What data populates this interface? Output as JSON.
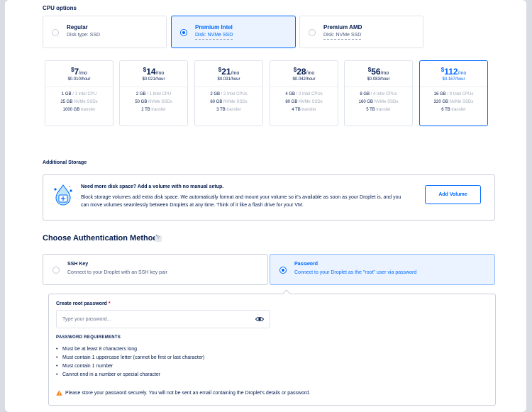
{
  "cpu_options": {
    "title": "CPU options",
    "options": [
      {
        "name": "Regular",
        "disk": "Disk type: SSD",
        "selected": false
      },
      {
        "name": "Premium Intel",
        "disk": "Disk: NVMe SSD",
        "selected": true
      },
      {
        "name": "Premium AMD",
        "disk": "Disk: NVMe SSD",
        "selected": false
      }
    ]
  },
  "plans": [
    {
      "dollar": "$",
      "price": "7",
      "per": "/mo",
      "hourly": "$0.010/hour",
      "spec1": "1 GB / 1 Intel CPU",
      "spec1_a": "1 GB",
      "spec1_b": " / 1 Intel CPU",
      "spec2_a": "25 GB",
      "spec2_b": " NVMe SSDs",
      "spec3_a": "1000 GB",
      "spec3_b": " transfer",
      "selected": false
    },
    {
      "dollar": "$",
      "price": "14",
      "per": "/mo",
      "hourly": "$0.021/hour",
      "spec1_a": "2 GB",
      "spec1_b": " / 1 Intel CPU",
      "spec2_a": "50 GB",
      "spec2_b": " NVMe SSDs",
      "spec3_a": "2 TB",
      "spec3_b": " transfer",
      "selected": false
    },
    {
      "dollar": "$",
      "price": "21",
      "per": "/mo",
      "hourly": "$0.031/hour",
      "spec1_a": "2 GB",
      "spec1_b": " / 2 Intel CPUs",
      "spec2_a": "60 GB",
      "spec2_b": " NVMe SSDs",
      "spec3_a": "3 TB",
      "spec3_b": " transfer",
      "selected": false
    },
    {
      "dollar": "$",
      "price": "28",
      "per": "/mo",
      "hourly": "$0.042/hour",
      "spec1_a": "4 GB",
      "spec1_b": " / 2 Intel CPUs",
      "spec2_a": "80 GB",
      "spec2_b": " NVMe SSDs",
      "spec3_a": "4 TB",
      "spec3_b": " transfer",
      "selected": false
    },
    {
      "dollar": "$",
      "price": "56",
      "per": "/mo",
      "hourly": "$0.083/hour",
      "spec1_a": "8 GB",
      "spec1_b": " / 4 Intel CPUs",
      "spec2_a": "160 GB",
      "spec2_b": " NVMe SSDs",
      "spec3_a": "5 TB",
      "spec3_b": " transfer",
      "selected": false
    },
    {
      "dollar": "$",
      "price": "112",
      "per": "/mo",
      "hourly": "$0.167/hour",
      "spec1_a": "16 GB",
      "spec1_b": " / 8 Intel CPUs",
      "spec2_a": "320 GB",
      "spec2_b": " NVMe SSDs",
      "spec3_a": "6 TB",
      "spec3_b": " transfer",
      "selected": true
    }
  ],
  "storage": {
    "title": "Additional Storage",
    "headline": "Need more disk space? Add a volume with no manual setup.",
    "body": "Block storage volumes add extra disk space. We automatically format and mount your volume so it's available as soon as your Droplet is, and you can move volumes seamlessly between Droplets at any time. Think of it like a flash drive for your VM.",
    "button": "Add Volume"
  },
  "auth": {
    "title": "Choose Authentication Method",
    "help": "?",
    "options": [
      {
        "name": "SSH Key",
        "desc": "Connect to your Droplet with an SSH key pair",
        "selected": false
      },
      {
        "name": "Password",
        "desc": "Connect to your Droplet as the \"root\" user via password",
        "selected": true
      }
    ],
    "password": {
      "label": "Create root password",
      "required_mark": "*",
      "placeholder": "Type your password...",
      "value": "",
      "requirements_title": "PASSWORD REQUIREMENTS",
      "requirements": [
        "Must be at least 8 characters long",
        "Must contain 1 uppercase letter (cannot be first or last character)",
        "Must contain 1 number",
        "Cannot end in a number or special character"
      ],
      "warning": "Please store your password securely. You will not be sent an email containing the Droplet's details or password."
    }
  },
  "colors": {
    "accent": "#0069ff",
    "warning": "#f5841f",
    "text": "#031b4e"
  },
  "icons": [
    "radio-icon",
    "volume-icon",
    "eye-icon",
    "warning-icon",
    "help-icon"
  ]
}
